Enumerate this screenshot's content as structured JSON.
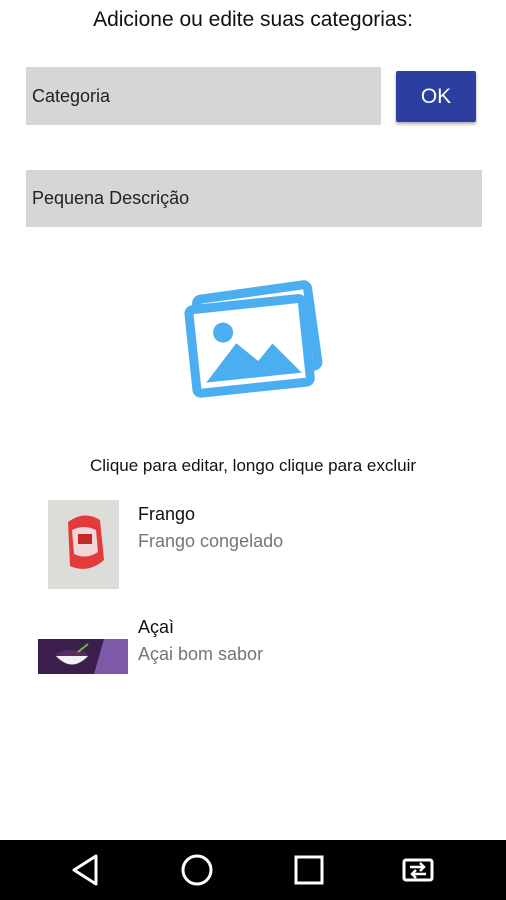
{
  "header": {
    "title": "Adicione ou edite suas categorias:"
  },
  "form": {
    "category_placeholder": "Categoria",
    "description_placeholder": "Pequena Descrição",
    "ok_label": "OK"
  },
  "hint": "Clique para editar, longo clique para excluir",
  "items": [
    {
      "title": "Frango",
      "subtitle": "Frango congelado"
    },
    {
      "title": "Açaì",
      "subtitle": "Açai bom sabor"
    }
  ],
  "colors": {
    "accent": "#2c3ea0",
    "image_icon": "#4aaef0",
    "field_bg": "#d6d6d6"
  },
  "icons": [
    "image-picker-icon",
    "back-icon",
    "home-icon",
    "recent-apps-icon",
    "switch-app-icon"
  ]
}
